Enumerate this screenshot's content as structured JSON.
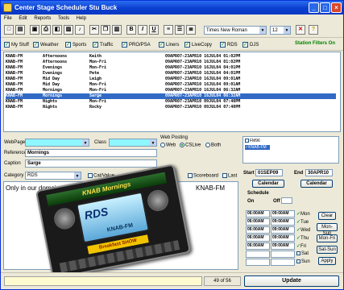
{
  "window": {
    "title": "Center Stage Scheduler Stu Buck"
  },
  "menu": [
    "File",
    "Edit",
    "Reports",
    "Tools",
    "Help"
  ],
  "toolbar": {
    "font": "Times New Roman",
    "size": "12",
    "icons": [
      "new-icon",
      "open-icon",
      "save-icon",
      "print-icon",
      "preview-icon",
      "image-icon",
      "music-icon",
      "cut-icon",
      "copy-icon",
      "paste-icon",
      "bold-icon",
      "italic-icon",
      "underline-icon",
      "align-left-icon",
      "align-center-icon",
      "align-right-icon",
      "close-icon",
      "help-icon"
    ],
    "bold": "B",
    "italic": "I",
    "underline": "U",
    "close": "✕",
    "help": "?"
  },
  "filters": [
    {
      "label": "My Stuff",
      "checked": true
    },
    {
      "label": "Weather",
      "checked": true
    },
    {
      "label": "Sports",
      "checked": true
    },
    {
      "label": "Traffic",
      "checked": true
    },
    {
      "label": "PRO/PSA",
      "checked": true
    },
    {
      "label": "Liners",
      "checked": true
    },
    {
      "label": "LiveCopy",
      "checked": true
    },
    {
      "label": "RDS",
      "checked": true
    },
    {
      "label": "DJS",
      "checked": true
    }
  ],
  "station_filters_label": "Station Filters On",
  "rows": [
    {
      "station": "KNAB-FM",
      "show": "Afternoons",
      "host": "Keith",
      "dates": "09APR07-23APR10 16JUL04 01:02PM",
      "selected": false
    },
    {
      "station": "KNAB-FM",
      "show": "Afternoons",
      "host": "Mon-Fri",
      "dates": "09APR07-23APR10 16JUL04 01:02PM",
      "selected": false
    },
    {
      "station": "KNAB-FM",
      "show": "Evenings",
      "host": "Mon-Fri",
      "dates": "09APR07-23APR10 16JUL04 04:01PM",
      "selected": false
    },
    {
      "station": "KNAB-FM",
      "show": "Evenings",
      "host": "Pete",
      "dates": "09APR07-23APR10 16JUL04 04:01PM",
      "selected": false
    },
    {
      "station": "KNAB-FM",
      "show": "Mid Day",
      "host": "Leigh",
      "dates": "09APR07-23APR10 16JUL04 09:01AM",
      "selected": false
    },
    {
      "station": "KNAB-FM",
      "show": "Mid Day",
      "host": "Mon-Fri",
      "dates": "09APR07-23APR10 16JUL04 09:01AM",
      "selected": false
    },
    {
      "station": "KNAB-FM",
      "show": "Mornings",
      "host": "Mon-Fri",
      "dates": "09APR07-23APR10 16JUL04 06:32AM",
      "selected": false
    },
    {
      "station": "KNAB-FM",
      "show": "Mornings",
      "host": "Sarge",
      "dates": "09APR07-23APR10 16JUL04 06:32AM",
      "selected": true
    },
    {
      "station": "KNAB-FM",
      "show": "Nights",
      "host": "Mon-Fri",
      "dates": "09APR07-23APR10 09JUL04 07:40PM",
      "selected": false
    },
    {
      "station": "KNAB-FM",
      "show": "Nights",
      "host": "Rocky",
      "dates": "09APR07-23APR10 09JUL04 07:40PM",
      "selected": false
    }
  ],
  "form": {
    "webpage_label": "WebPage",
    "class_label": "Class",
    "webposting_label": "Web Posting",
    "web_label": "Web",
    "cslive_label": "CSLive",
    "both_label": "Both",
    "reference_label": "Reference",
    "reference_value": "Mornings",
    "caption_label": "Caption",
    "caption_value": "Sarge",
    "category_label": "Category",
    "category_value": "RDS",
    "cat_value_label": "Cat/Value",
    "scoreboard_label": "Scoreboard",
    "last_label": "Last"
  },
  "editor": {
    "text_left": "Only in our domain",
    "text_right": "KNAB-FM"
  },
  "stations": [
    {
      "name": "FM96",
      "checked": false
    },
    {
      "name": "KNAB-FM",
      "checked": true
    }
  ],
  "schedule": {
    "start_label": "Start",
    "start_value": "01SEP09",
    "end_label": "End",
    "end_value": "30APR10",
    "calendar_label": "Calendar",
    "schedule_label": "Schedule",
    "on_label": "On",
    "off_label": "Off",
    "rows": [
      {
        "on": "06:00AM",
        "off": "09:00AM",
        "day": "Mon",
        "checked": true,
        "btn": "Clear"
      },
      {
        "on": "06:00AM",
        "off": "09:00AM",
        "day": "Tue",
        "checked": true,
        "btn": "Mon-Sun"
      },
      {
        "on": "06:00AM",
        "off": "09:00AM",
        "day": "Wed",
        "checked": true,
        "btn": "Mon-Fri"
      },
      {
        "on": "06:00AM",
        "off": "09:00AM",
        "day": "Thu",
        "checked": true,
        "btn": "Sat-Sun"
      },
      {
        "on": "06:00AM",
        "off": "09:00AM",
        "day": "Fri",
        "checked": true,
        "btn": "Apply"
      },
      {
        "on": "",
        "off": "",
        "day": "Sat",
        "checked": false,
        "btn": ""
      },
      {
        "on": "",
        "off": "",
        "day": "Sun",
        "checked": false,
        "btn": ""
      }
    ],
    "update_label": "Update"
  },
  "status": {
    "record": "49 of 56"
  },
  "preview": {
    "top_banner": "KNAB Mornings",
    "rds_logo": "RDS",
    "station_text": "KNAB-FM",
    "bottom_text": "Breakfast SHOW"
  }
}
